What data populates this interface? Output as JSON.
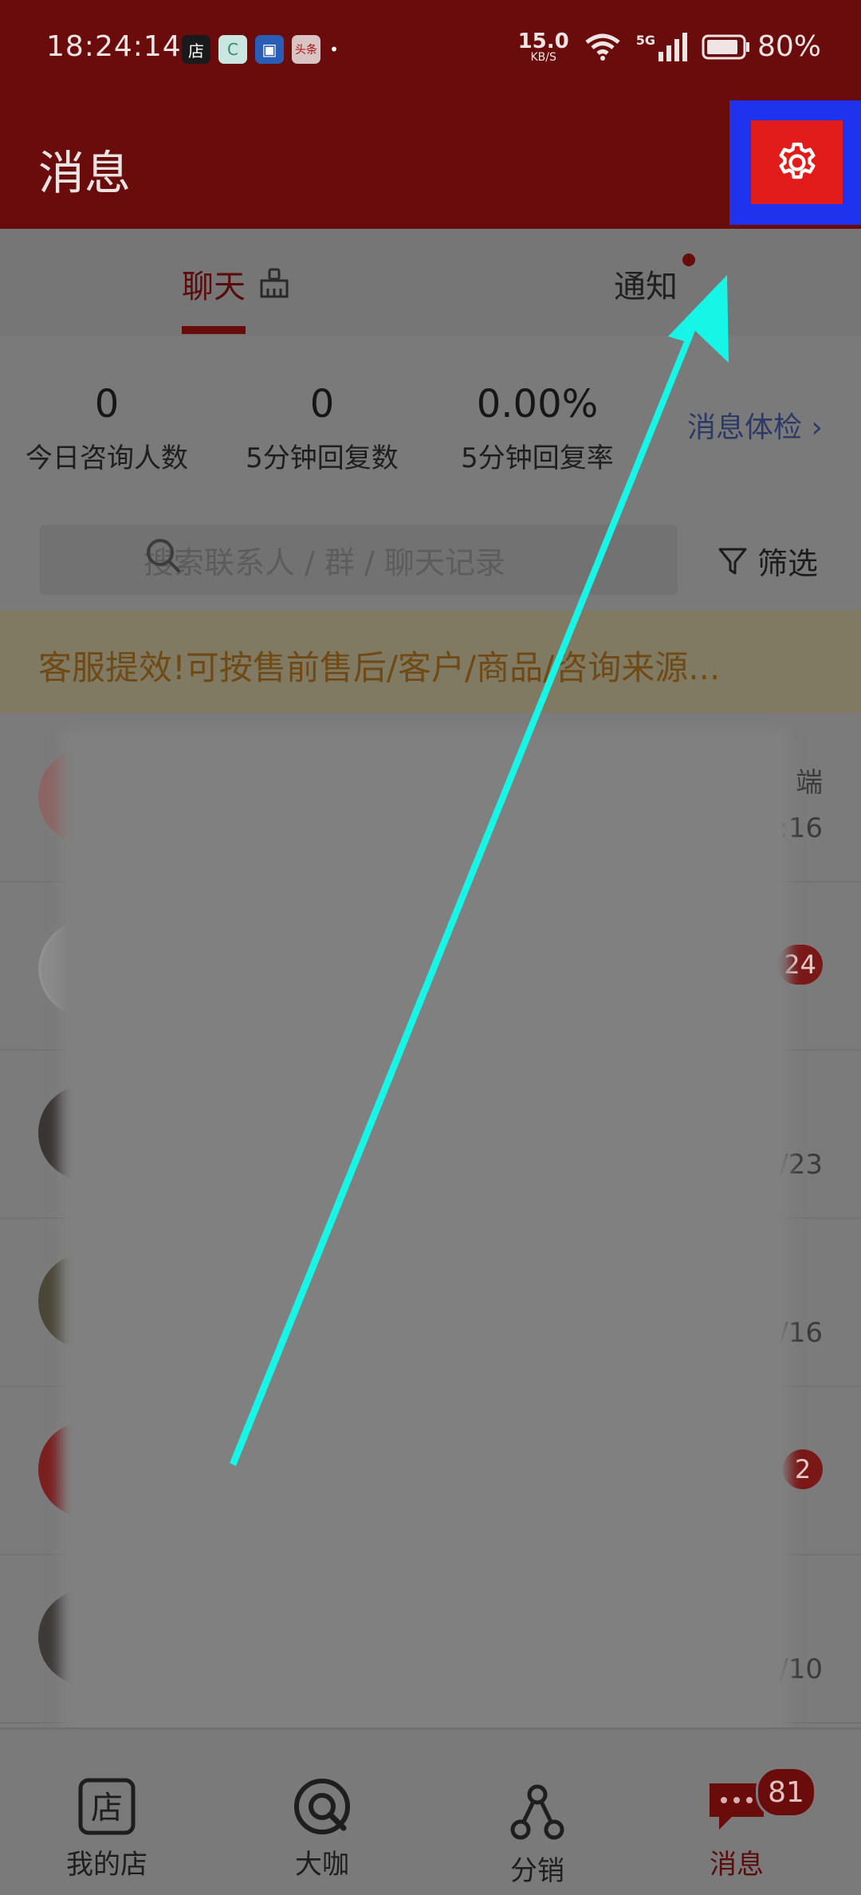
{
  "status_bar": {
    "time": "18:24:14",
    "app_icons": [
      "店",
      "C",
      "▣",
      "头条"
    ],
    "net_speed_top": "15.0",
    "net_speed_unit": "KB/S",
    "signal": "5G",
    "battery": "80%"
  },
  "header": {
    "title": "消息"
  },
  "tabs": {
    "chat_label": "聊天",
    "notice_label": "通知"
  },
  "stats": [
    {
      "value": "0",
      "label": "今日咨询人数"
    },
    {
      "value": "0",
      "label": "5分钟回复数"
    },
    {
      "value": "0.00%",
      "label": "5分钟回复率"
    }
  ],
  "health_check": "消息体检",
  "search": {
    "placeholder": "搜索联系人 / 群 / 聊天记录",
    "filter_label": "筛选"
  },
  "banner": {
    "text": "客服提效!可按售前售后/客户/商品/咨询来源..."
  },
  "conversations": [
    {
      "meta_top": "端",
      "meta": ":16",
      "badge": ""
    },
    {
      "meta_top": "",
      "meta": "",
      "badge": "24"
    },
    {
      "meta_top": "",
      "meta": "/23",
      "badge": ""
    },
    {
      "meta_top": "",
      "meta": "/16",
      "badge": ""
    },
    {
      "meta_top": "",
      "meta": "",
      "badge": "2"
    },
    {
      "meta_top": "",
      "meta": "/10",
      "badge": ""
    }
  ],
  "bottom_nav": [
    {
      "label": "我的店",
      "icon": "store-icon"
    },
    {
      "label": "大咖",
      "icon": "discover-icon"
    },
    {
      "label": "分销",
      "icon": "distribution-icon"
    },
    {
      "label": "消息",
      "icon": "message-icon"
    }
  ],
  "nav_badge": "81",
  "colors": {
    "header_red": "#6b0c0c",
    "settings_highlight_blue": "#1f33ee",
    "settings_button_red": "#e21b1b",
    "arrow_cyan": "#16f5e6"
  }
}
